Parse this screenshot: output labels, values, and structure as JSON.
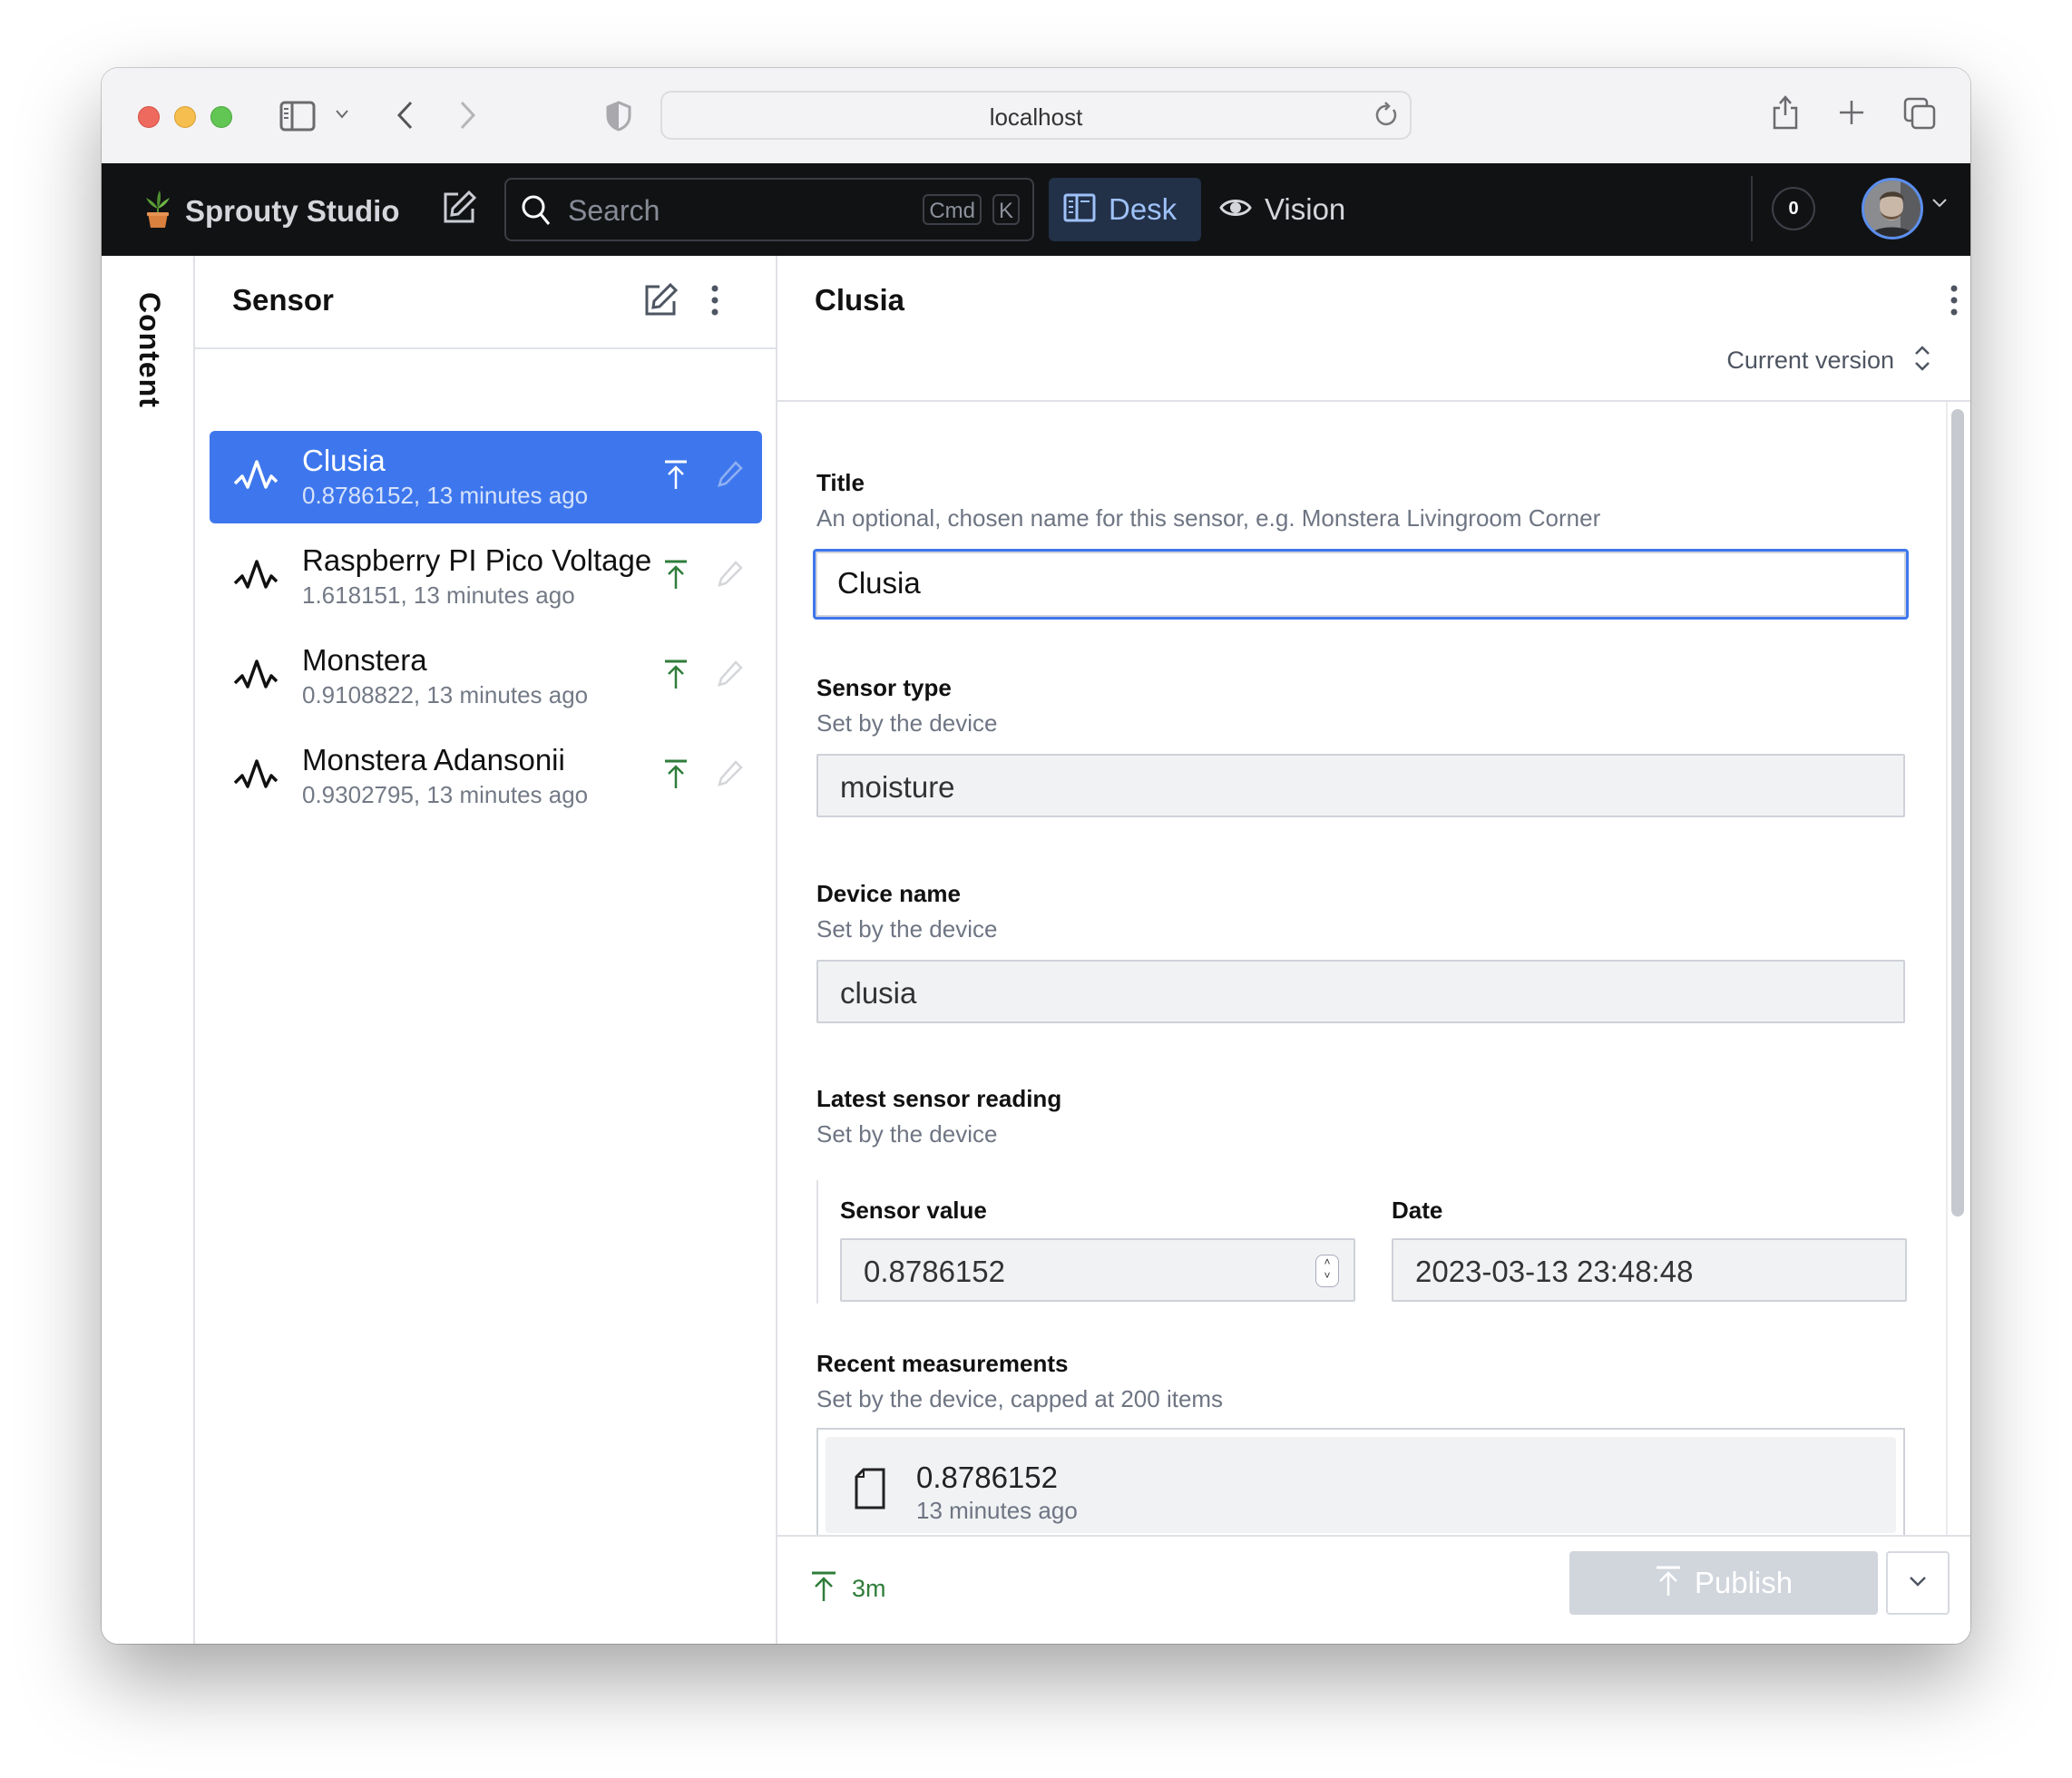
{
  "browser": {
    "address": "localhost"
  },
  "app": {
    "brand": "Sprouty Studio",
    "search_placeholder": "Search",
    "shortcut_keys": [
      "Cmd",
      "K"
    ],
    "tools": [
      {
        "label": "Desk",
        "icon": "desk-icon",
        "active": true
      },
      {
        "label": "Vision",
        "icon": "eye-icon",
        "active": false
      }
    ],
    "notification_count": "0",
    "accent_color": "#3e77ed"
  },
  "rail": {
    "label": "Content"
  },
  "list_pane": {
    "title": "Sensor",
    "items": [
      {
        "title": "Clusia",
        "subtitle": "0.8786152, 13 minutes ago",
        "selected": true
      },
      {
        "title": "Raspberry PI Pico Voltage",
        "subtitle": "1.618151, 13 minutes ago",
        "selected": false
      },
      {
        "title": "Monstera",
        "subtitle": "0.9108822, 13 minutes ago",
        "selected": false
      },
      {
        "title": "Monstera Adansonii",
        "subtitle": "0.9302795, 13 minutes ago",
        "selected": false
      }
    ]
  },
  "document": {
    "title": "Clusia",
    "version_label": "Current version",
    "fields": {
      "title": {
        "label": "Title",
        "description": "An optional, chosen name for this sensor, e.g. Monstera Livingroom Corner",
        "value": "Clusia"
      },
      "sensor_type": {
        "label": "Sensor type",
        "description": "Set by the device",
        "value": "moisture"
      },
      "device_name": {
        "label": "Device name",
        "description": "Set by the device",
        "value": "clusia"
      },
      "latest_reading": {
        "label": "Latest sensor reading",
        "description": "Set by the device",
        "sensor_value_label": "Sensor value",
        "sensor_value": "0.8786152",
        "date_label": "Date",
        "date_value": "2023-03-13 23:48:48"
      },
      "recent_measurements": {
        "label": "Recent measurements",
        "description": "Set by the device, capped at 200 items",
        "items": [
          {
            "value": "0.8786152",
            "time": "13 minutes ago"
          }
        ]
      }
    },
    "footer": {
      "status": "3m",
      "publish_label": "Publish"
    }
  }
}
